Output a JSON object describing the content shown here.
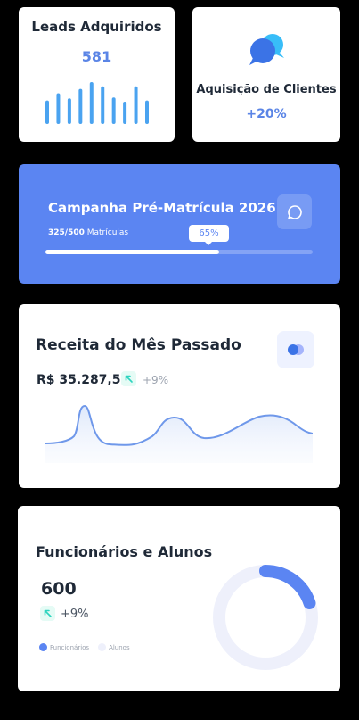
{
  "leads": {
    "title": "Leads Adquiridos",
    "value": "581",
    "bar_levels": [
      0.55,
      0.72,
      0.6,
      0.82,
      0.98,
      0.88,
      0.62,
      0.52,
      0.88,
      0.55
    ],
    "bar_color": "#4aa3f0"
  },
  "acquisition": {
    "title": "Aquisição de Clientes",
    "change": "+20%",
    "icon": "chat-bubbles-icon"
  },
  "campaign": {
    "title": "Campanha Pré-Matrícula 2026",
    "progress_count": "325/500",
    "progress_label": "Matrículas",
    "progress_percent_label": "65%",
    "progress_fraction": 0.65,
    "icon": "message-icon",
    "color": "#5b85f2"
  },
  "revenue": {
    "title": "Receita do Mês Passado",
    "value": "R$ 35.287,50",
    "change": "+9%",
    "icon": "toggle-icon",
    "accent": "#5b85e6"
  },
  "staff": {
    "title": "Funcionários e Alunos",
    "value": "600",
    "change": "+9%",
    "legend": [
      {
        "label": "Funcionários",
        "color": "#5b85f2"
      },
      {
        "label": "Alunos",
        "color": "#eef0fb"
      }
    ],
    "funcionarios_fraction": 0.2
  }
}
